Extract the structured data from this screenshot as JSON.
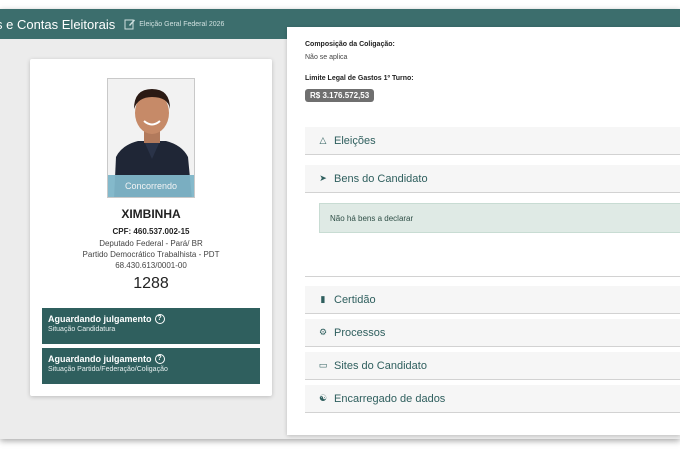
{
  "header": {
    "title": "s e Contas Eleitorais",
    "election": "Eleição Geral Federal 2026",
    "edit_icon": "edit-icon"
  },
  "candidate": {
    "status": "Concorrendo",
    "name": "XIMBINHA",
    "cpf": "CPF: 460.537.002-15",
    "office": "Deputado Federal - Pará/ BR",
    "party": "Partido Democrático Trabalhista - PDT",
    "cnpj": "68.430.613/0001-00",
    "number": "1288"
  },
  "situations": [
    {
      "title": "Aguardando julgamento",
      "subtitle": "Situação Candidatura"
    },
    {
      "title": "Aguardando julgamento",
      "subtitle": "Situação Partido/Federação/Coligação"
    }
  ],
  "info": {
    "coalition_label": "Composição da Coligação:",
    "coalition_value": "Não se aplica",
    "limit_label": "Limite Legal de Gastos 1º Turno:",
    "limit_value": "R$ 3.176.572,53"
  },
  "sections": {
    "eleicoes": "Eleições",
    "bens": "Bens do Candidato",
    "bens_note": "Não há bens a declarar",
    "certidao": "Certidão",
    "processos": "Processos",
    "sites": "Sites do Candidato",
    "encarregado": "Encarregado de dados"
  },
  "colors": {
    "brand": "#3c6e6d",
    "situation_bg": "#2f5f5e",
    "status_strip": "#7fb6c9"
  }
}
